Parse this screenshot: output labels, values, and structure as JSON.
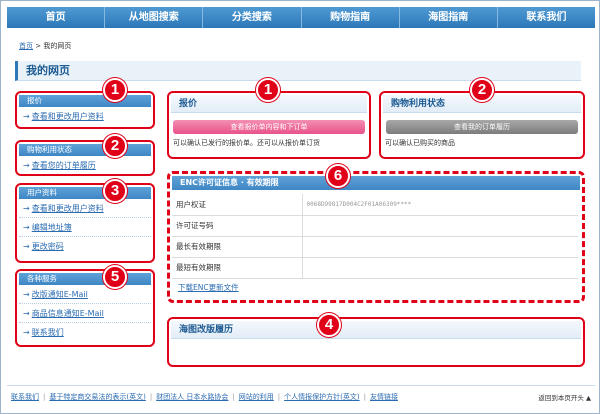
{
  "nav": {
    "items": [
      "首页",
      "从地图搜索",
      "分类搜索",
      "购物指南",
      "海图指南",
      "联系我们"
    ]
  },
  "breadcrumb": {
    "home": "首页",
    "sep": " > ",
    "current": "我的网页"
  },
  "page_title": "我的网页",
  "sidebar": {
    "quote": {
      "title": "报价",
      "links": [
        "查看和更改用户资料"
      ]
    },
    "purchase": {
      "title": "购物利用状态",
      "links": [
        "查看您的订单履历"
      ]
    },
    "user": {
      "title": "用户资料",
      "links": [
        "查看和更改用户资料",
        "编辑地址簿",
        "更改密码"
      ]
    },
    "services": {
      "title": "各种服务",
      "links": [
        "改版通知E-Mail",
        "商品信息通知E-Mail",
        "联系我们"
      ]
    }
  },
  "panels": {
    "quote": {
      "title": "报价",
      "button": "查看报价单内容和下订单",
      "note": "可以确认已发行的报价单。还可以从报价单订货"
    },
    "purchase": {
      "title": "购物利用状态",
      "button": "查看我的订单履历",
      "note": "可以确认已购买的商品"
    },
    "enc": {
      "title": "ENC许可证信息 · 有效期限",
      "rows": [
        {
          "label": "用户权证",
          "value": "0068D99817D004C2F01A06309****"
        },
        {
          "label": "许可证号码",
          "value": ""
        },
        {
          "label": "最长有效期限",
          "value": ""
        },
        {
          "label": "最短有效期限",
          "value": ""
        }
      ],
      "link": "下载ENC更新文件"
    },
    "history": {
      "title": "海图改版履历"
    }
  },
  "badges": [
    "1",
    "1",
    "2",
    "2",
    "3",
    "4",
    "5",
    "6"
  ],
  "footer": {
    "links": [
      "联系我们",
      "基于特定商交易法的表示(英文)",
      "财团法人 日本水路协会",
      "网站的利用",
      "个人情报保护方针(英文)",
      "友情链接"
    ],
    "top": "返回到本页开头 ▲"
  },
  "colors": {
    "accent": "#2c78b8",
    "highlight": "#e00018"
  }
}
